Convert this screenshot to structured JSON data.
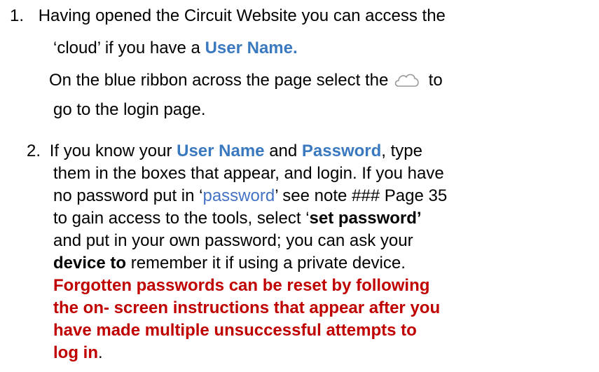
{
  "step1": {
    "number": "1.",
    "line1": "Having opened the Circuit Website you can access the",
    "line2_text": "‘cloud’ if you have a",
    "line2_bold": "User Name.",
    "line3_before": "On the blue ribbon across the page select  the",
    "cloud_icon": "cloud-icon",
    "line3_after": "to",
    "line4": "go to the login page."
  },
  "step2": {
    "number": "2.",
    "l1_a": "If you know your",
    "l1_user": "User Name",
    "l1_b": "and",
    "l1_password": "Password",
    "l1_c": ", type",
    "l2": "them in the boxes that appear, and login. If you have",
    "l3_a": "no password put in ‘",
    "l3_pw": "password",
    "l3_b": "’ see note ### Page 35",
    "l4_a": "to gain access to the tools, select  ‘",
    "l4_set": "set password’",
    "l5": "and put in your own password; you can ask your",
    "l6_bold": "device to",
    "l6_rest": " remember it if using a private device.",
    "red1": "Forgotten passwords can be reset by following",
    "red2": "the on- screen instructions that appear after you",
    "red3": "have made multiple unsuccessful attempts to",
    "red4": "log in",
    "red4_end": "."
  },
  "colors": {
    "accent_blue": "#3a79c0",
    "warning_red": "#c00000"
  }
}
